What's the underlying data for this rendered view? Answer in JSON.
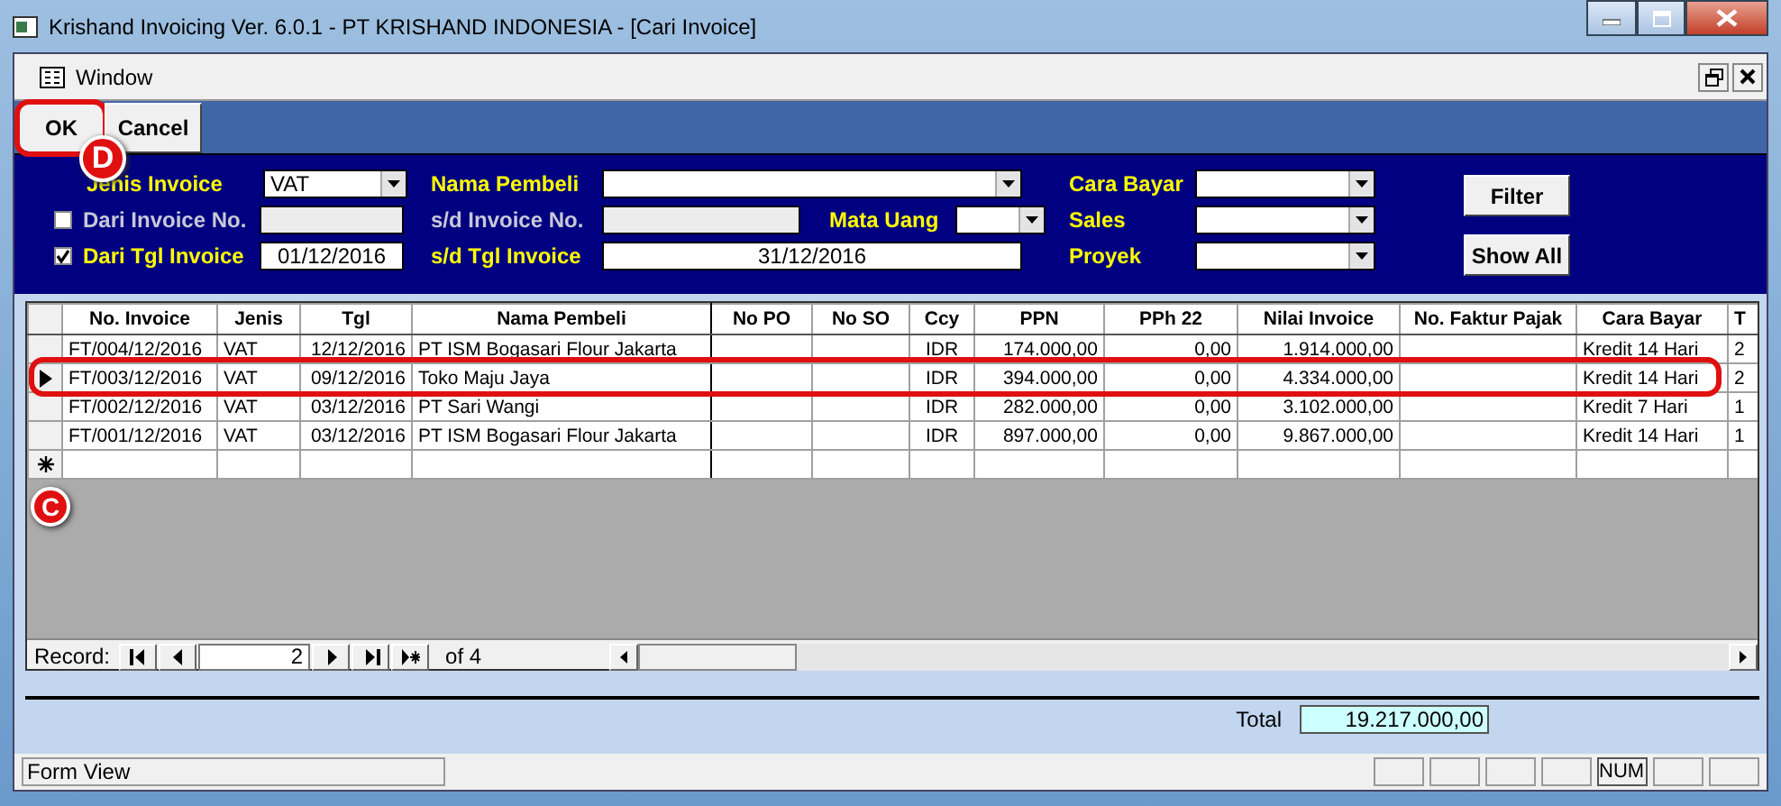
{
  "window": {
    "title": "Krishand Invoicing Ver. 6.0.1 - PT KRISHAND INDONESIA - [Cari Invoice]"
  },
  "menu": [
    "Window"
  ],
  "toolbar": [
    {
      "label": "OK",
      "callout": "D"
    },
    {
      "label": "Cancel"
    }
  ],
  "filter_groups": [
    {
      "rows": [
        [
          {
            "label": "Jenis Invoice",
            "kind": "combo",
            "value": "VAT"
          }
        ],
        [
          {
            "label": "Dari Invoice No.",
            "kind": "text",
            "disabled": true,
            "checked": false
          }
        ],
        [
          {
            "label": "Dari Tgl Invoice",
            "kind": "text",
            "value": "01/12/2016",
            "checked": true
          }
        ]
      ]
    },
    {
      "rows": [
        [
          {
            "label": "Nama Pembeli",
            "kind": "combo"
          }
        ],
        [
          {
            "label": "s/d  Invoice No.",
            "kind": "text",
            "disabled": true
          },
          {
            "label": "Mata Uang",
            "kind": "combo"
          }
        ],
        [
          {
            "label": "s/d Tgl Invoice",
            "kind": "text",
            "value": "31/12/2016"
          }
        ]
      ]
    },
    {
      "rows": [
        [
          {
            "label": "Cara Bayar",
            "kind": "combo"
          }
        ],
        [
          {
            "label": "Sales",
            "kind": "combo"
          }
        ],
        [
          {
            "label": "Proyek",
            "kind": "combo"
          }
        ]
      ]
    }
  ],
  "filter_buttons": [
    "Filter",
    "Show All"
  ],
  "table": {
    "columns": [
      {
        "label": "No. Invoice"
      },
      {
        "label": "Jenis"
      },
      {
        "label": "Tgl"
      },
      {
        "label": "Nama Pembeli"
      },
      {
        "label": "No PO"
      },
      {
        "label": "No SO"
      },
      {
        "label": "Ccy"
      },
      {
        "label": "PPN"
      },
      {
        "label": "PPh 22"
      },
      {
        "label": "Nilai Invoice"
      },
      {
        "label": "No. Faktur Pajak"
      },
      {
        "label": "Cara Bayar"
      },
      {
        "label": "T"
      }
    ],
    "rows": [
      {
        "selected": false,
        "cells": [
          "FT/004/12/2016",
          "VAT",
          "12/12/2016",
          "PT ISM Bogasari Flour Jakarta",
          "",
          "",
          "IDR",
          "174.000,00",
          "0,00",
          "1.914.000,00",
          "",
          "Kredit 14 Hari",
          "2"
        ]
      },
      {
        "selected": true,
        "callout": "C",
        "cells": [
          "FT/003/12/2016",
          "VAT",
          "09/12/2016",
          "Toko Maju Jaya",
          "",
          "",
          "IDR",
          "394.000,00",
          "0,00",
          "4.334.000,00",
          "",
          "Kredit 14 Hari",
          "2"
        ]
      },
      {
        "selected": false,
        "cells": [
          "FT/002/12/2016",
          "VAT",
          "03/12/2016",
          "PT Sari Wangi",
          "",
          "",
          "IDR",
          "282.000,00",
          "0,00",
          "3.102.000,00",
          "",
          "Kredit 7 Hari",
          "1"
        ]
      },
      {
        "selected": false,
        "cells": [
          "FT/001/12/2016",
          "VAT",
          "03/12/2016",
          "PT ISM Bogasari Flour Jakarta",
          "",
          "",
          "IDR",
          "897.000,00",
          "0,00",
          "9.867.000,00",
          "",
          "Kredit 14 Hari",
          "1"
        ]
      }
    ],
    "new_record_row": true
  },
  "navigator": {
    "label": "Record:",
    "value": "2",
    "count": "of 4"
  },
  "total": {
    "label": "Total",
    "value": "19.217.000,00"
  },
  "status_bar": {
    "text": "Form View",
    "indicators": [
      {
        "active": false
      },
      {
        "active": false
      },
      {
        "active": false
      },
      {
        "active": false
      },
      {
        "active": true,
        "label": "NUM"
      },
      {
        "active": false
      },
      {
        "active": false
      }
    ]
  }
}
